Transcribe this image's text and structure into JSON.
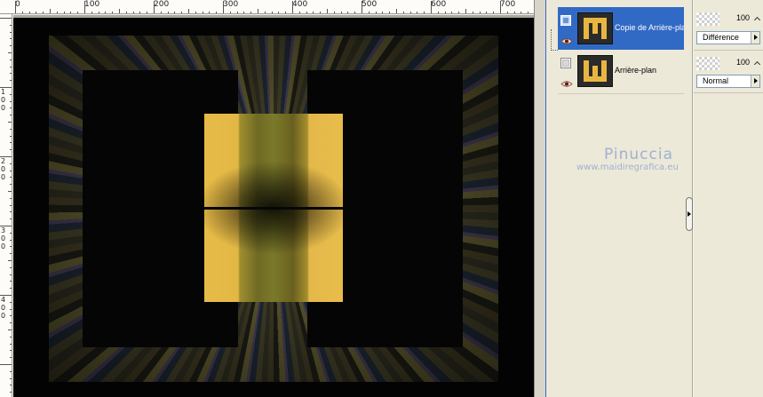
{
  "ruler": {
    "top_labels": [
      "0",
      "100",
      "200",
      "300",
      "400",
      "500",
      "600",
      "700"
    ],
    "left_labels": [
      "1",
      "0",
      "0",
      "2",
      "0",
      "0",
      "3",
      "0",
      "0",
      "4",
      "0",
      "0"
    ]
  },
  "layers": [
    {
      "name": "Copie de Arrière-plan",
      "selected": true,
      "opacity": "100",
      "blend_mode": "Différence"
    },
    {
      "name": "Arrière-plan",
      "selected": false,
      "opacity": "100",
      "blend_mode": "Normal"
    }
  ],
  "watermark": {
    "name": "Pinuccia",
    "url": "www.maidiregrafica.eu"
  },
  "colors": {
    "selection": "#316ac5",
    "gold": "#e7bb47",
    "panel_bg": "#ece9d8",
    "canvas_bg": "#030303"
  },
  "icons": {
    "visibility": "eye-icon",
    "mask": "layer-mask-icon",
    "collapse": "chevron-right-icon",
    "dropdown": "dropdown-arrow-icon"
  }
}
